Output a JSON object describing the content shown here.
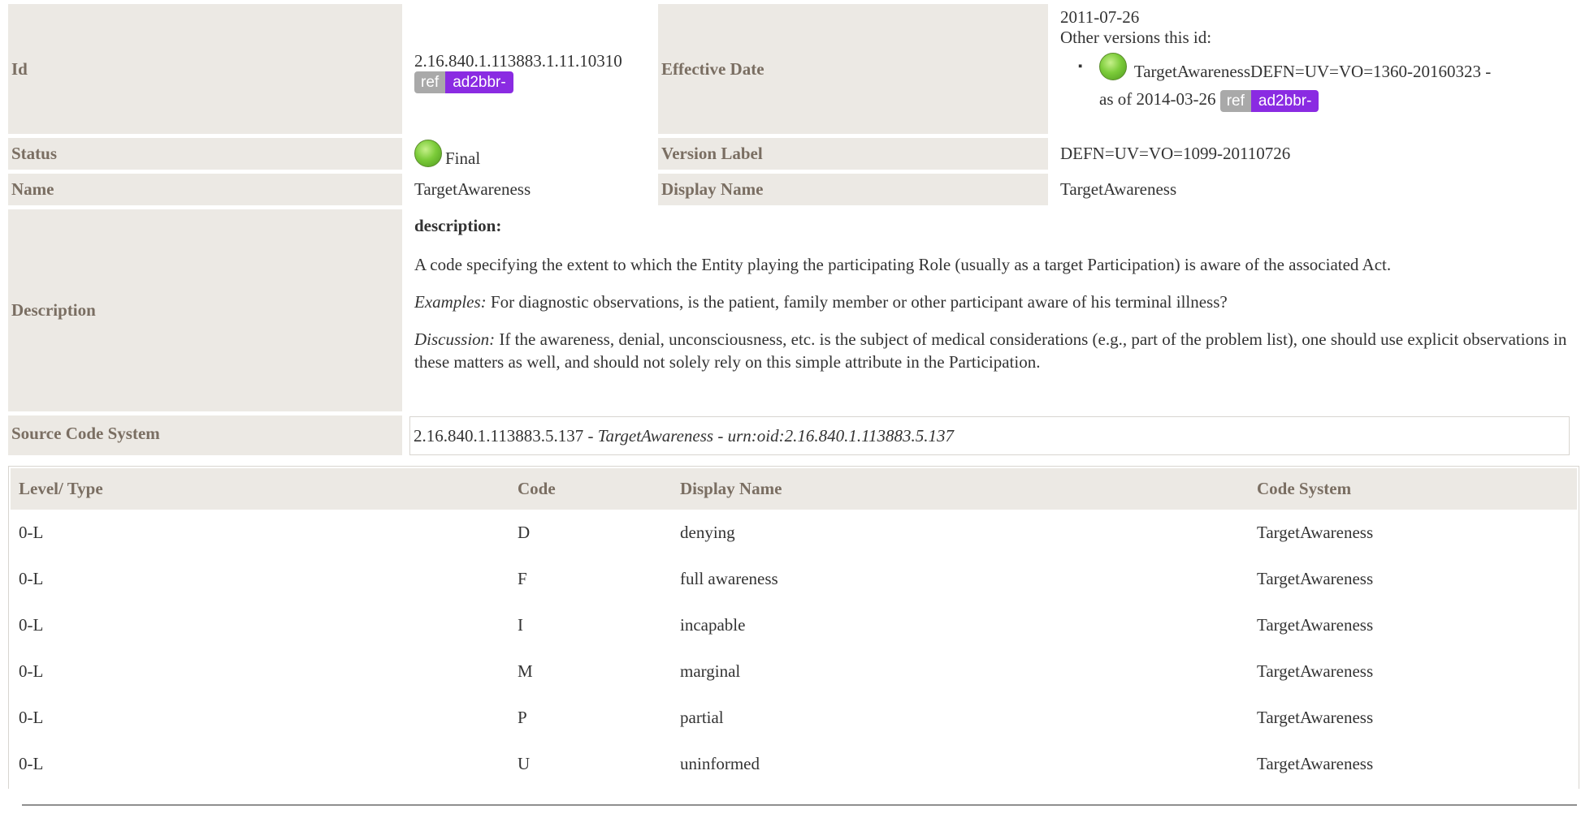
{
  "meta": {
    "id_label": "Id",
    "id_value": "2.16.840.1.113883.1.11.10310",
    "effective_label": "Effective Date",
    "effective_value": "2011-07-26",
    "other_versions_label": "Other versions this id:",
    "other_versions": [
      {
        "name": "TargetAwarenessDEFN=UV=VO=1360-20160323 -",
        "as_of": "as of 2014-03-26"
      }
    ],
    "status_label": "Status",
    "status_value": "Final",
    "version_label_label": "Version Label",
    "version_label_value": "DEFN=UV=VO=1099-20110726",
    "name_label": "Name",
    "name_value": "TargetAwareness",
    "display_name_label": "Display Name",
    "display_name_value": "TargetAwareness",
    "description_label": "Description",
    "description_title": "description:",
    "description_text": "A code specifying the extent to which the Entity playing the participating Role (usually as a target Participation) is aware of the associated Act.",
    "examples_label": "Examples:",
    "examples_text": " For diagnostic observations, is the patient, family member or other participant aware of his terminal illness?",
    "discussion_label": "Discussion:",
    "discussion_text": " If the awareness, denial, unconsciousness, etc. is the subject of medical considerations (e.g., part of the problem list), one should use explicit observations in these matters as well, and should not solely rely on this simple attribute in the Participation.",
    "source_label": "Source Code System",
    "source_oid": "2.16.840.1.113883.5.137",
    "source_sep1": " - ",
    "source_name": "TargetAwareness",
    "source_sep2": " - ",
    "source_urn": "urn:oid:2.16.840.1.113883.5.137"
  },
  "badge": {
    "ref": "ref",
    "prefix": "ad2bbr-"
  },
  "colors": {
    "header_bg": "#ece9e4",
    "label_text": "#7a6e62",
    "badge_ref": "#a9a9a9",
    "badge_prefix": "#8a2be2",
    "status_dot": "#7ccc3a"
  },
  "icons": {
    "status": "status-final-green-dot-icon"
  },
  "codes": {
    "headers": [
      "Level/ Type",
      "Code",
      "Display Name",
      "Code System"
    ],
    "rows": [
      [
        "0-L",
        "D",
        "denying",
        "TargetAwareness"
      ],
      [
        "0-L",
        "F",
        "full awareness",
        "TargetAwareness"
      ],
      [
        "0-L",
        "I",
        "incapable",
        "TargetAwareness"
      ],
      [
        "0-L",
        "M",
        "marginal",
        "TargetAwareness"
      ],
      [
        "0-L",
        "P",
        "partial",
        "TargetAwareness"
      ],
      [
        "0-L",
        "U",
        "uninformed",
        "TargetAwareness"
      ]
    ]
  }
}
